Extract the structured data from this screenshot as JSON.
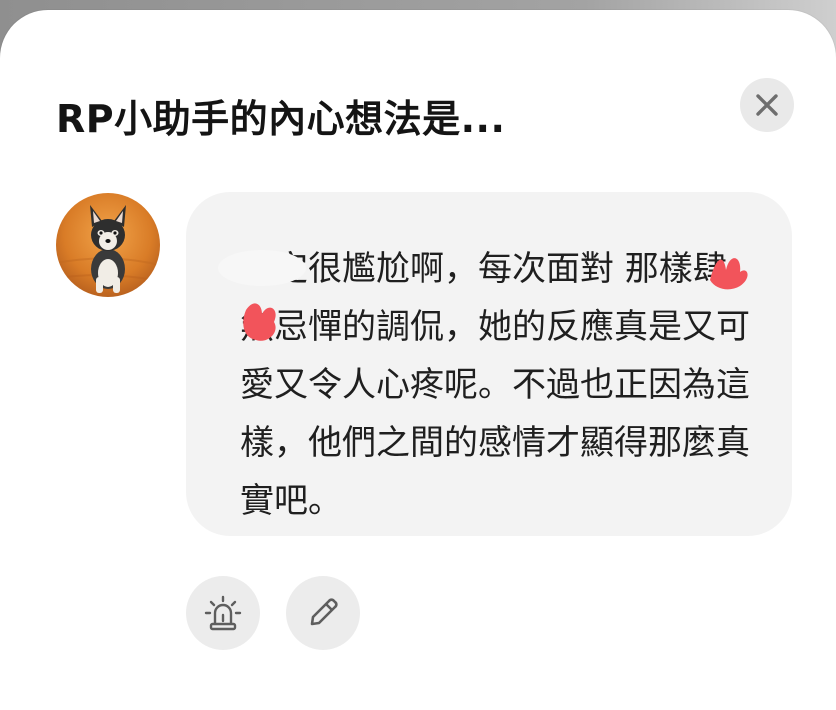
{
  "dialog": {
    "title": "RP小助手的內心想法是..."
  },
  "message": {
    "text": "一定很尷尬啊，每次面對 那樣肆無忌憚的調侃，她的反應真是又可愛又令人心疼呢。不過也正因為這樣，他們之間的感情才顯得那麼真實吧。"
  },
  "icons": {
    "close": "close-icon",
    "alarm": "alarm-icon",
    "edit": "pencil-icon"
  },
  "colors": {
    "bubble": "#f3f3f3",
    "button_bg": "#ececec",
    "redaction": "#f2545b"
  }
}
